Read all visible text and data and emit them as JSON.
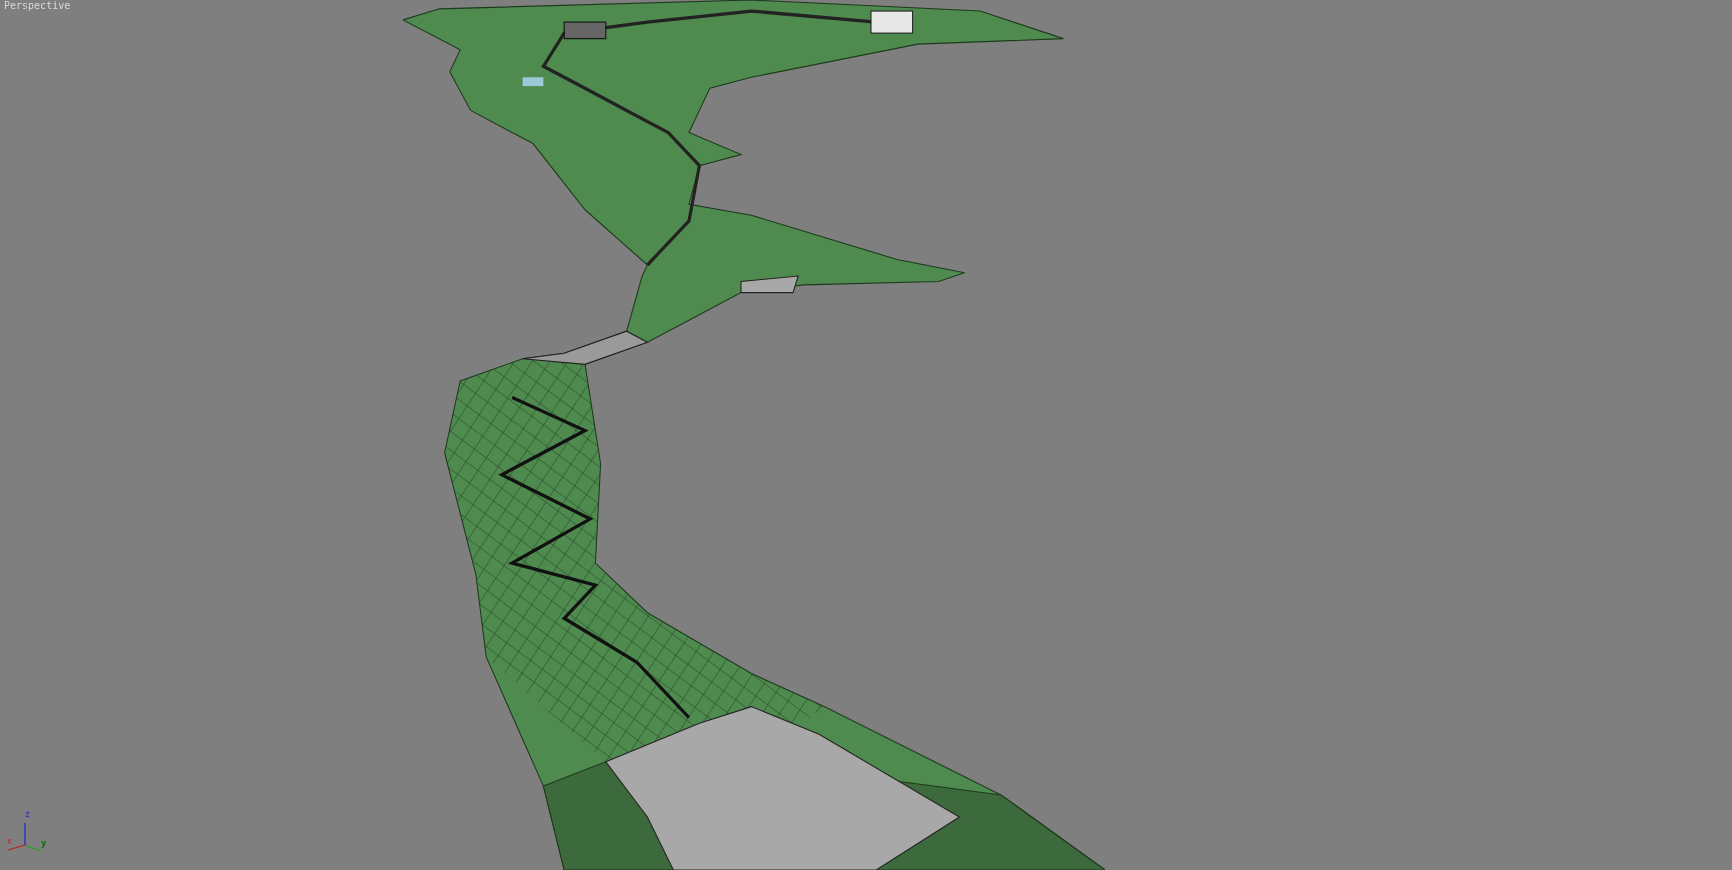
{
  "viewport": {
    "label": "Perspective"
  },
  "axis_gizmo": {
    "x_label": "x",
    "y_label": "y",
    "z_label": "z"
  }
}
